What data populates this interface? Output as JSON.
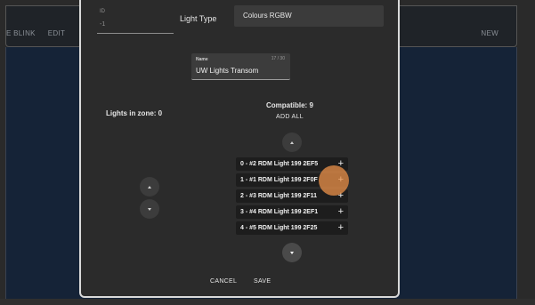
{
  "background": {
    "nav_items": [
      "E BLINK",
      "EDIT"
    ],
    "new_label": "NEW"
  },
  "dialog": {
    "id_field": {
      "label": "ID",
      "value": "-1"
    },
    "light_type": {
      "label": "Light Type",
      "value": "Colours RGBW"
    },
    "name_field": {
      "label": "Name",
      "counter": "17 / 30",
      "value": "UW Lights Transom"
    },
    "zone": {
      "label": "Lights in zone: 0"
    },
    "compatible": {
      "label": "Compatible: 9",
      "add_all": "ADD ALL"
    },
    "lights": [
      {
        "label": "0 - #2 RDM Light 199 2EF5",
        "add": "+"
      },
      {
        "label": "1 - #1 RDM Light 199 2F0F",
        "add": "+"
      },
      {
        "label": "2 - #3 RDM Light 199 2F11",
        "add": "+"
      },
      {
        "label": "3 - #4 RDM Light 199 2EF1",
        "add": "+"
      },
      {
        "label": "4 - #5 RDM Light 199 2F25",
        "add": "+"
      }
    ],
    "cancel_label": "CANCEL",
    "save_label": "SAVE"
  },
  "colors": {
    "dialog_bg": "#2b2b2b",
    "app_bg": "#152337",
    "ripple": "#ec924a"
  }
}
